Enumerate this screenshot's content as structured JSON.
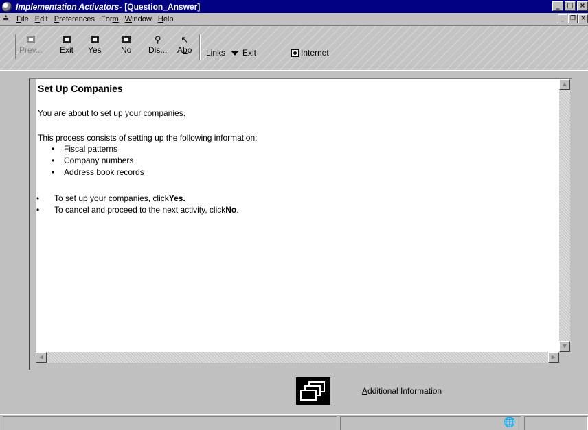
{
  "window": {
    "title_app": "Implementation Activators",
    "title_sep": " - ",
    "title_doc": "[Question_Answer]",
    "min": "_",
    "max": "□",
    "close": "×"
  },
  "menu": {
    "items": [
      {
        "u": "F",
        "rest": "ile"
      },
      {
        "u": "E",
        "rest": "dit"
      },
      {
        "u": "P",
        "rest": "references"
      },
      {
        "pre": "For",
        "u": "m",
        "rest": ""
      },
      {
        "u": "W",
        "rest": "indow"
      },
      {
        "u": "H",
        "rest": "elp"
      }
    ]
  },
  "toolbar": {
    "prev": "Prev...",
    "exit": "Exit",
    "yes": "Yes",
    "no": "No",
    "dis": "Dis...",
    "abo_pre": "A",
    "abo_u": "b",
    "abo_post": "o",
    "links": "Links",
    "exit2": "Exit",
    "internet": "Internet"
  },
  "content": {
    "heading": "Set Up Companies",
    "intro": "You are about to set up your companies.",
    "process": "This process consists of setting up the following information:",
    "items": [
      "Fiscal patterns",
      "Company numbers",
      "Address book records"
    ],
    "bullet": "•",
    "action1_text": "To set up your companies, click ",
    "action1_bold": "Yes.",
    "action2_text": "To cancel and proceed to the next activity, click ",
    "action2_bold": "No",
    "action2_end": "."
  },
  "additional": {
    "label_u": "A",
    "label_rest": "dditional Information"
  }
}
